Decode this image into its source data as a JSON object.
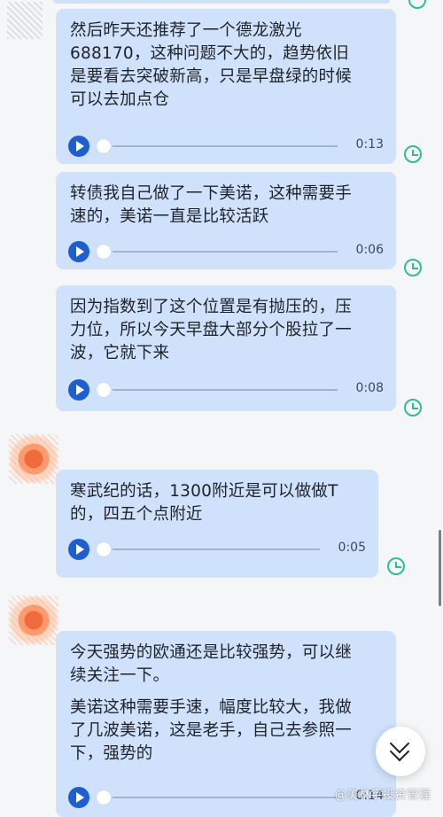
{
  "messages": [
    {
      "lines": [
        "然后昨天还推荐了一个德龙激光",
        "688170，这种问题不大的，趋势依旧",
        "是要看去突破新高，只是早盘绿的时候",
        "可以去加点仓"
      ],
      "duration": "0:13"
    },
    {
      "lines": [
        "转债我自己做了一下美诺，这种需要手",
        "速的，美诺一直是比较活跃"
      ],
      "duration": "0:06"
    },
    {
      "lines": [
        "因为指数到了这个位置是有抛压的，压",
        "力位，所以今天早盘大部分个股拉了一",
        "波，它就下来"
      ],
      "duration": "0:08"
    },
    {
      "lines": [
        "寒武纪的话，1300附近是可以做做T",
        "的，四五个点附近"
      ],
      "duration": "0:05"
    },
    {
      "para1": [
        "今天强势的欧通还是比较强势，可以继",
        "续关注一下。"
      ],
      "para2": [
        "美诺这种需要手速，幅度比较大，我做",
        "了几波美诺，这是老手，自己去参照一",
        "下，强势的"
      ],
      "duration": "0:14"
    }
  ],
  "watermark": "@美林宇投资管理",
  "colors": {
    "bubble": "#cfe1fb",
    "play": "#1d5fd0",
    "status": "#2fbf8e",
    "background": "#f4f6f8"
  },
  "icons": {
    "play": "play-icon",
    "status": "clock-check-icon",
    "scroll": "chevron-double-down-icon"
  }
}
